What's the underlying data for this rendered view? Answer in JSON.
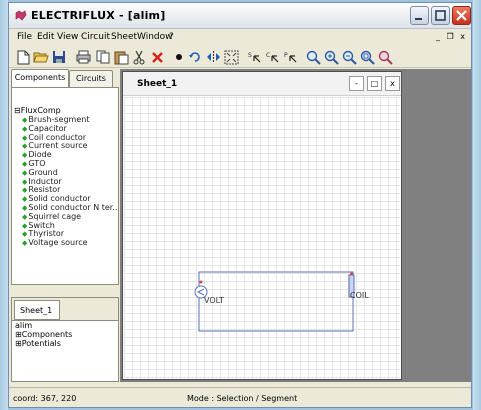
{
  "app": {
    "title": "ELECTRIFLUX - [alim]"
  },
  "menu": {
    "items": [
      "File",
      "Edit",
      "View",
      "Circuit",
      "Sheet",
      "Window",
      "?"
    ],
    "mdi_controls": "_ &#x1F5D7; x"
  },
  "toolbar": {
    "icons": [
      "new-file-icon",
      "open-folder-icon",
      "save-icon",
      "print-icon",
      "copy-icon",
      "paste-icon",
      "cut-icon",
      "delete-icon",
      "point-icon",
      "rotate-icon",
      "flip-icon",
      "fit-icon",
      "select-s-icon",
      "select-c-icon",
      "select-p-icon",
      "zoom-icon",
      "zoom-in-icon",
      "zoom-out-icon",
      "zoom-fit-icon",
      "zoom-window-icon"
    ]
  },
  "left_panel": {
    "tabs": [
      "Components",
      "Circuits"
    ],
    "tree_root": "FluxComp",
    "components": [
      "Brush-segment",
      "Capacitor",
      "Coil conductor",
      "Current source",
      "Diode",
      "GTO",
      "Ground",
      "Inductor",
      "Resistor",
      "Solid conductor",
      "Solid conductor N ter...",
      "Squirrel cage",
      "Switch",
      "Thyristor",
      "Voltage source"
    ]
  },
  "sheet_panel": {
    "tab": "Sheet_1",
    "items": [
      "alim",
      "Components",
      "Potentials"
    ]
  },
  "document": {
    "title": "Sheet_1",
    "controls": [
      "-",
      "□",
      "x"
    ],
    "labels": {
      "volt": "VOLT",
      "coil": "COIL"
    }
  },
  "status": {
    "coord": "coord: 367, 220",
    "mode": "Mode : Selection / Segment"
  },
  "colors": {
    "accent_green": "#2aa12a",
    "circuit_wire": "#5a6fb5",
    "close_red": "#c8301b"
  }
}
